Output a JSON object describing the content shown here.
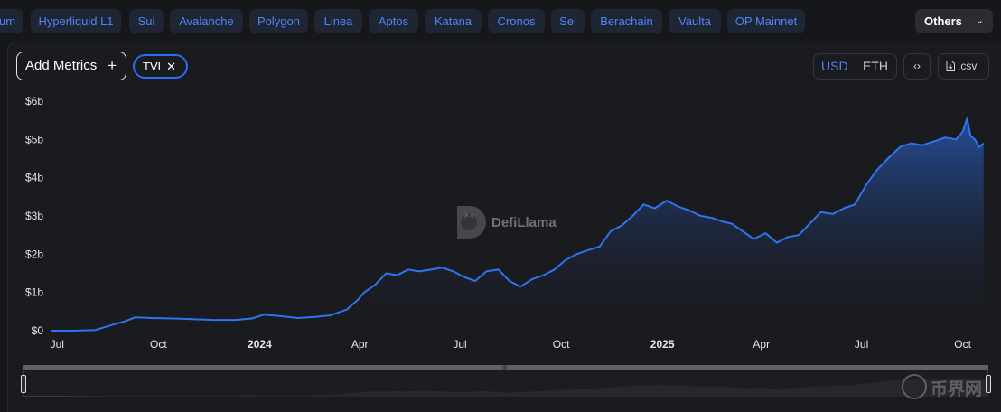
{
  "chain_tabs": [
    "um",
    "Hyperliquid L1",
    "Sui",
    "Avalanche",
    "Polygon",
    "Linea",
    "Aptos",
    "Katana",
    "Cronos",
    "Sei",
    "Berachain",
    "Vaulta",
    "OP Mainnet"
  ],
  "others_label": "Others",
  "add_metrics_label": "Add Metrics",
  "metric_pill_label": "TVL",
  "currency": {
    "usd": "USD",
    "eth": "ETH",
    "selected": "USD"
  },
  "csv_label": ".csv",
  "watermark": "DefiLlama",
  "stamp_text": "币界网",
  "colors": {
    "accent": "#2d6bef",
    "line": "#2f74ef",
    "tab_text": "#4f86f7"
  },
  "chart_data": {
    "type": "area",
    "series": [
      {
        "name": "TVL",
        "x": [
          "2023-06-25",
          "2023-07-15",
          "2023-08-05",
          "2023-08-20",
          "2023-09-01",
          "2023-09-10",
          "2023-09-25",
          "2023-10-15",
          "2023-11-01",
          "2023-11-20",
          "2023-12-10",
          "2023-12-25",
          "2024-01-05",
          "2024-01-20",
          "2024-02-05",
          "2024-02-20",
          "2024-03-05",
          "2024-03-20",
          "2024-03-30",
          "2024-04-05",
          "2024-04-15",
          "2024-04-25",
          "2024-05-05",
          "2024-05-15",
          "2024-05-25",
          "2024-06-05",
          "2024-06-15",
          "2024-06-25",
          "2024-07-05",
          "2024-07-15",
          "2024-07-25",
          "2024-08-05",
          "2024-08-15",
          "2024-08-25",
          "2024-09-05",
          "2024-09-15",
          "2024-09-25",
          "2024-10-05",
          "2024-10-15",
          "2024-10-25",
          "2024-11-05",
          "2024-11-15",
          "2024-11-25",
          "2024-12-05",
          "2024-12-15",
          "2024-12-25",
          "2025-01-05",
          "2025-01-15",
          "2025-01-25",
          "2025-02-05",
          "2025-02-15",
          "2025-02-25",
          "2025-03-05",
          "2025-03-15",
          "2025-03-25",
          "2025-04-05",
          "2025-04-15",
          "2025-04-25",
          "2025-05-05",
          "2025-05-15",
          "2025-05-25",
          "2025-06-05",
          "2025-06-15",
          "2025-06-25",
          "2025-07-05",
          "2025-07-15",
          "2025-07-25",
          "2025-08-05",
          "2025-08-15",
          "2025-08-25",
          "2025-09-05",
          "2025-09-15",
          "2025-09-25",
          "2025-10-01",
          "2025-10-05",
          "2025-10-08",
          "2025-10-12",
          "2025-10-16",
          "2025-10-20"
        ],
        "y": [
          0,
          0,
          0.02,
          0.15,
          0.25,
          0.35,
          0.33,
          0.32,
          0.3,
          0.28,
          0.28,
          0.32,
          0.42,
          0.38,
          0.33,
          0.36,
          0.4,
          0.55,
          0.8,
          1.0,
          1.2,
          1.5,
          1.45,
          1.6,
          1.55,
          1.6,
          1.65,
          1.55,
          1.4,
          1.3,
          1.55,
          1.6,
          1.3,
          1.15,
          1.35,
          1.45,
          1.6,
          1.85,
          2.0,
          2.1,
          2.2,
          2.6,
          2.75,
          3.0,
          3.3,
          3.2,
          3.4,
          3.25,
          3.15,
          3.0,
          2.95,
          2.85,
          2.8,
          2.6,
          2.4,
          2.55,
          2.3,
          2.45,
          2.5,
          2.8,
          3.1,
          3.05,
          3.2,
          3.3,
          3.8,
          4.2,
          4.5,
          4.8,
          4.9,
          4.85,
          4.95,
          5.05,
          5.0,
          5.2,
          5.55,
          5.1,
          5.0,
          4.8,
          4.9
        ]
      }
    ],
    "x_ticks": [
      {
        "label": "Jul",
        "date": "2023-07-01",
        "bold": false
      },
      {
        "label": "Oct",
        "date": "2023-10-01",
        "bold": false
      },
      {
        "label": "2024",
        "date": "2024-01-01",
        "bold": true
      },
      {
        "label": "Apr",
        "date": "2024-04-01",
        "bold": false
      },
      {
        "label": "Jul",
        "date": "2024-07-01",
        "bold": false
      },
      {
        "label": "Oct",
        "date": "2024-10-01",
        "bold": false
      },
      {
        "label": "2025",
        "date": "2025-01-01",
        "bold": true
      },
      {
        "label": "Apr",
        "date": "2025-04-01",
        "bold": false
      },
      {
        "label": "Jul",
        "date": "2025-07-01",
        "bold": false
      },
      {
        "label": "Oct",
        "date": "2025-10-01",
        "bold": false
      }
    ],
    "y_ticks": [
      {
        "label": "$0",
        "value": 0
      },
      {
        "label": "$1b",
        "value": 1
      },
      {
        "label": "$2b",
        "value": 2
      },
      {
        "label": "$3b",
        "value": 3
      },
      {
        "label": "$4b",
        "value": 4
      },
      {
        "label": "$5b",
        "value": 5
      },
      {
        "label": "$6b",
        "value": 6
      }
    ],
    "ylim": [
      0,
      6
    ],
    "xlim": [
      "2023-06-25",
      "2025-10-21"
    ],
    "grid": false,
    "legend": "none"
  }
}
